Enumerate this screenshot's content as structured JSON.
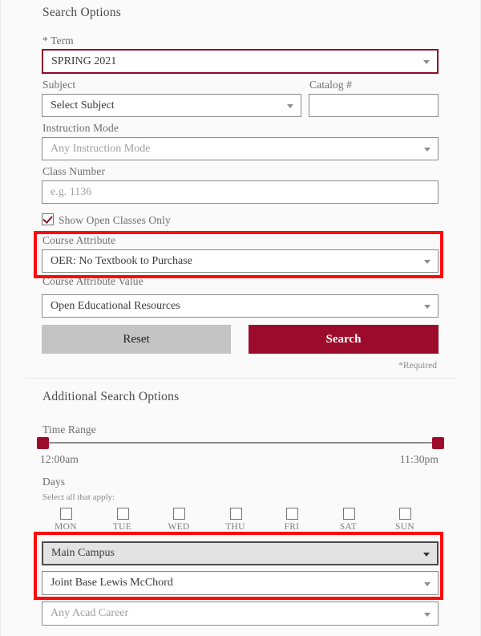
{
  "search_options": {
    "title": "Search Options",
    "term": {
      "label": "* Term",
      "value": "SPRING 2021",
      "highlight_color": "#8e0c28"
    },
    "subject": {
      "label": "Subject",
      "value": "Select Subject"
    },
    "catalog": {
      "label": "Catalog #",
      "value": "",
      "placeholder": ""
    },
    "instruction_mode": {
      "label": "Instruction Mode",
      "value": "Any Instruction Mode"
    },
    "class_number": {
      "label": "Class Number",
      "placeholder": "e.g. 1136",
      "value": ""
    },
    "open_classes": {
      "label": "Show Open Classes Only",
      "checked": true
    },
    "course_attribute": {
      "label": "Course Attribute",
      "value": "OER: No Textbook to Purchase"
    },
    "course_attribute_value": {
      "label": "Course Attribute Value",
      "value": "Open Educational Resources"
    },
    "reset_label": "Reset",
    "search_label": "Search",
    "required_note": "*Required"
  },
  "additional_search_options": {
    "title": "Additional Search Options",
    "time_range": {
      "label": "Time Range",
      "start": "12:00am",
      "end": "11:30pm",
      "handle_color": "#9c0b2b"
    },
    "days": {
      "label": "Days",
      "hint": "Select all that apply:",
      "items": [
        {
          "label": "MON",
          "checked": false
        },
        {
          "label": "TUE",
          "checked": false
        },
        {
          "label": "WED",
          "checked": false
        },
        {
          "label": "THU",
          "checked": false
        },
        {
          "label": "FRI",
          "checked": false
        },
        {
          "label": "SAT",
          "checked": false
        },
        {
          "label": "SUN",
          "checked": false
        }
      ]
    },
    "campus": {
      "value": "Main Campus"
    },
    "location": {
      "value": "Joint Base Lewis McChord"
    },
    "acad_career": {
      "value": "Any Acad Career"
    }
  },
  "annotations": {
    "color": "#fb0a0a",
    "boxes": [
      {
        "name": "course-attribute-highlight"
      },
      {
        "name": "campus-location-highlight"
      }
    ]
  }
}
